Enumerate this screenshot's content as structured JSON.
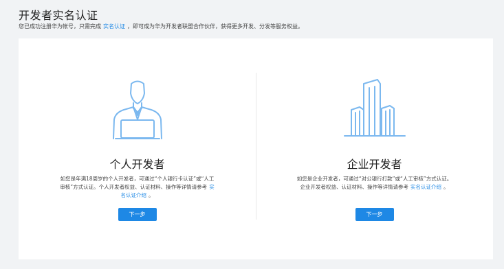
{
  "header": {
    "title": "开发者实名认证",
    "intro_before": "您已成功注册华为帐号，只需完成",
    "intro_link": "实名认证",
    "intro_after": "，即可成为华为开发者联盟合作伙伴，获得更多开发、分发等服务权益。"
  },
  "cards": {
    "personal": {
      "icon": "person-laptop-icon",
      "title": "个人开发者",
      "description": "如您是年满18周岁的个人开发者，可通过“个人银行卡认证”或“人工审核”方式认证。个人开发者权益、认证材料、操作等详情请参考",
      "link_text": "实名认证介绍",
      "suffix": "。",
      "button_label": "下一步"
    },
    "enterprise": {
      "icon": "buildings-icon",
      "title": "企业开发者",
      "description": "如您是企业开发者，可通过“对公银行打款”或“人工审核”方式认证。企业开发者权益、认证材料、操作等详情请参考",
      "link_text": "实名认证介绍",
      "suffix": "。",
      "button_label": "下一步"
    }
  },
  "colors": {
    "accent": "#1e88e5",
    "illustration": "#7bb8ef",
    "background": "#f1f3f5"
  }
}
